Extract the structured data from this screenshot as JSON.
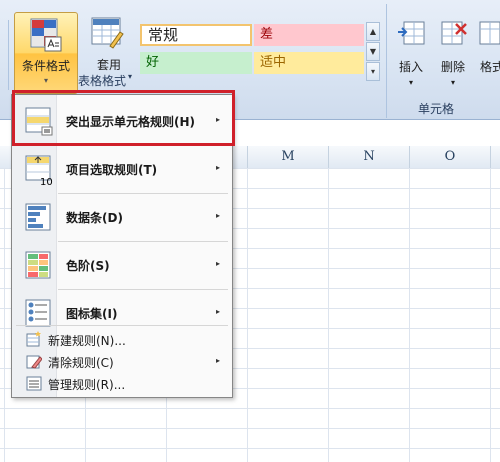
{
  "ribbon": {
    "conditional_formatting": {
      "label": "条件格式",
      "dropdown": "▾"
    },
    "table_format": {
      "label": "套用",
      "label2": "表格格式",
      "dropdown": "▾"
    },
    "styles": {
      "normal": "常规",
      "bad": "差",
      "good": "好",
      "neutral": "适中"
    },
    "cells_group": {
      "insert": "插入",
      "delete": "删除",
      "format": "格式",
      "group_label": "单元格"
    },
    "colors": {
      "bad_bg": "#ffc7ce",
      "bad_fg": "#9c0006",
      "good_bg": "#c6efce",
      "good_fg": "#006100",
      "neutral_bg": "#ffeb9c",
      "neutral_fg": "#9c6500",
      "highlight_border": "#d0202a"
    }
  },
  "columns": [
    "M",
    "N",
    "O"
  ],
  "menu": {
    "items": [
      {
        "label": "突出显示单元格规则(H)",
        "icon": "highlight-cells-rules-icon",
        "submenu": true,
        "highlighted": true
      },
      {
        "label": "项目选取规则(T)",
        "icon": "top-bottom-rules-icon",
        "submenu": true
      },
      {
        "label": "数据条(D)",
        "icon": "data-bars-icon",
        "submenu": true
      },
      {
        "label": "色阶(S)",
        "icon": "color-scales-icon",
        "submenu": true
      },
      {
        "label": "图标集(I)",
        "icon": "icon-sets-icon",
        "submenu": true
      }
    ],
    "small_items": [
      {
        "label": "新建规则(N)...",
        "icon": "new-rule-icon",
        "submenu": false
      },
      {
        "label": "清除规则(C)",
        "icon": "clear-rules-icon",
        "submenu": true
      },
      {
        "label": "管理规则(R)...",
        "icon": "manage-rules-icon",
        "submenu": false
      }
    ],
    "submenu_arrow": "▸",
    "top_items_value": "10"
  }
}
